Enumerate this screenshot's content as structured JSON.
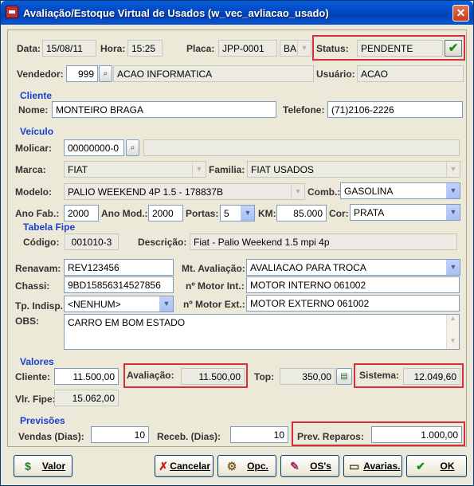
{
  "window": {
    "title": "Avaliação/Estoque Virtual de Usados (w_vec_avliacao_usado)"
  },
  "header": {
    "data_label": "Data:",
    "data": "15/08/11",
    "hora_label": "Hora:",
    "hora": "15:25",
    "placa_label": "Placa:",
    "placa": "JPP-0001",
    "uf": "BA",
    "status_label": "Status:",
    "status": "PENDENTE",
    "vendedor_label": "Vendedor:",
    "vendedor_code": "999",
    "vendedor_name": "ACAO INFORMATICA",
    "usuario_label": "Usuário:",
    "usuario": "ACAO"
  },
  "cliente": {
    "section": "Cliente",
    "nome_label": "Nome:",
    "nome": "MONTEIRO BRAGA",
    "telefone_label": "Telefone:",
    "telefone": "(71)2106-2226"
  },
  "veiculo": {
    "section": "Veículo",
    "molicar_label": "Molicar:",
    "molicar": "00000000-0",
    "molicar_desc": "",
    "marca_label": "Marca:",
    "marca": "FIAT",
    "familia_label": "Familia:",
    "familia": "FIAT USADOS",
    "modelo_label": "Modelo:",
    "modelo": "PALIO WEEKEND 4P 1.5 - 178837B",
    "comb_label": "Comb.:",
    "comb": "GASOLINA",
    "anofab_label": "Ano Fab.:",
    "anofab": "2000",
    "anomod_label": "Ano Mod.:",
    "anomod": "2000",
    "portas_label": "Portas:",
    "portas": "5",
    "km_label": "KM:",
    "km": "85.000",
    "cor_label": "Cor:",
    "cor": "PRATA"
  },
  "fipe": {
    "section": "Tabela Fipe",
    "codigo_label": "Código:",
    "codigo": "001010-3",
    "descricao_label": "Descrição:",
    "descricao": "Fiat - Palio Weekend 1.5 mpi 4p"
  },
  "detalhes": {
    "renavam_label": "Renavam:",
    "renavam": "REV123456",
    "mtaval_label": "Mt. Avaliação:",
    "mtaval": "AVALIACAO PARA TROCA",
    "chassi_label": "Chassi:",
    "chassi": "9BD15856314527856",
    "motorint_label": "nº Motor Int.:",
    "motorint": "MOTOR INTERNO 061002",
    "tpindisp_label": "Tp. Indisp.:",
    "tpindisp": "<NENHUM>",
    "motorext_label": "nº Motor Ext.:",
    "motorext": "MOTOR EXTERNO 061002",
    "obs_label": "OBS:",
    "obs": "CARRO EM BOM ESTADO"
  },
  "valores": {
    "section": "Valores",
    "cliente_label": "Cliente:",
    "cliente": "11.500,00",
    "avaliacao_label": "Avaliação:",
    "avaliacao": "11.500,00",
    "top_label": "Top:",
    "top": "350,00",
    "sistema_label": "Sistema:",
    "sistema": "12.049,60",
    "fipe_label": "Vlr. Fipe:",
    "fipe": "15.062,00"
  },
  "previsoes": {
    "section": "Previsões",
    "vendas_label": "Vendas (Dias):",
    "vendas": "10",
    "receb_label": "Receb. (Dias):",
    "receb": "10",
    "reparos_label": "Prev. Reparos:",
    "reparos": "1.000,00"
  },
  "buttons": {
    "valor": "Valor",
    "cancelar": "Cancelar",
    "opc": "Opc.",
    "oss": "OS's",
    "avarias": "Avarias.",
    "ok": "OK"
  },
  "colors": {
    "highlight": "#d62e3a",
    "section": "#1a3fd0"
  }
}
